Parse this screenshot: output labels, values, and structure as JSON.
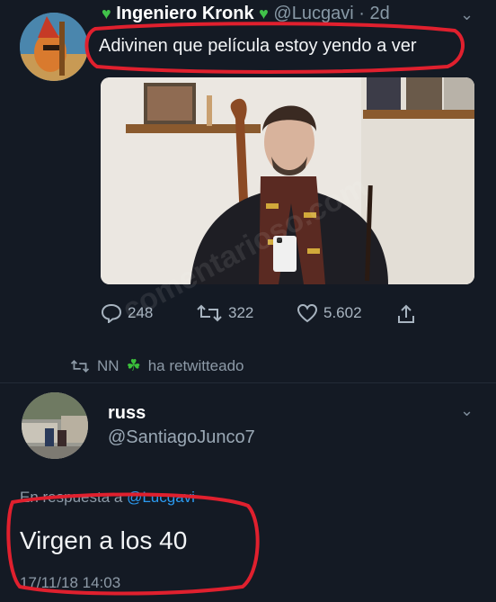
{
  "tweet": {
    "author_name": "Ingeniero Kronk",
    "author_handle": "@Lucgavi",
    "time": "· 2d",
    "text": "Adivinen que película estoy yendo a ver",
    "stats": {
      "replies": "248",
      "retweets": "322",
      "likes": "5.602"
    }
  },
  "retweet_notice": {
    "user": "NN",
    "text": "ha retwitteado"
  },
  "reply": {
    "author_name": "russ",
    "author_handle": "@SantiagoJunco7",
    "in_reply_to_label": "En respuesta a",
    "in_reply_to_mention": "@Lucgavi",
    "text": "Virgen a los 40",
    "timestamp": "17/11/18 14:03"
  },
  "watermark": "comentarioso.com",
  "colors": {
    "background": "#141a24",
    "annotation_red": "#e0202e",
    "link_blue": "#2b9af0",
    "verified_green": "#41c24a"
  }
}
